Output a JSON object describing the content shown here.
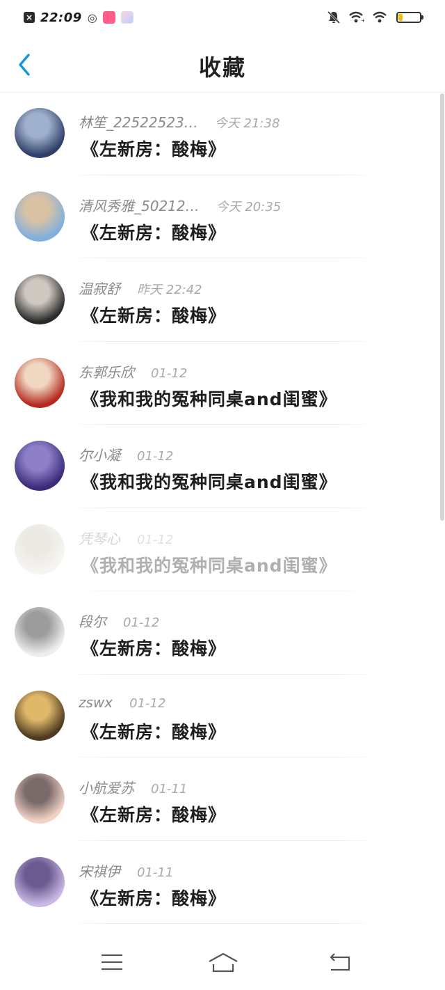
{
  "status_bar": {
    "time": "22:09",
    "battery_level": 0.2,
    "icons": [
      "close-notification-icon",
      "weibo-icon",
      "app-icon-1",
      "app-icon-2",
      "mute-bell-icon",
      "wifi-calling-icon",
      "wifi-icon",
      "battery-icon"
    ]
  },
  "header": {
    "title": "收藏",
    "back_icon": "chevron-left-icon"
  },
  "colors": {
    "accent": "#1296db",
    "name": "#8a8a8a",
    "time": "#a9a9a9",
    "title": "#1e1e1e",
    "battery": "#f5c000"
  },
  "items": [
    {
      "name": "林笙_22522523…",
      "time": "今天 21:38",
      "title": "《左新房：酸梅》",
      "avatar_colors": [
        "#2f3f69",
        "#9fb0cc"
      ]
    },
    {
      "name": "清风秀雅_50212…",
      "time": "今天 20:35",
      "title": "《左新房：酸梅》",
      "avatar_colors": [
        "#7fb0dd",
        "#d9c2a4"
      ]
    },
    {
      "name": "温寂舒",
      "time": "昨天 22:42",
      "title": "《左新房：酸梅》",
      "avatar_colors": [
        "#2a2a2a",
        "#cfc8c0"
      ]
    },
    {
      "name": "东郭乐欣",
      "time": "01-12",
      "title": "《我和我的冤种同桌and闺蜜》",
      "avatar_colors": [
        "#b52a1f",
        "#f0d7c2"
      ]
    },
    {
      "name": "尔小凝",
      "time": "01-12",
      "title": "《我和我的冤种同桌and闺蜜》",
      "avatar_colors": [
        "#3b2b7a",
        "#8d80c8"
      ]
    },
    {
      "name": "凭琴心",
      "time": "01-12",
      "title": "《我和我的冤种同桌and闺蜜》",
      "avatar_colors": [
        "#e9e4d8",
        "#c9c2b2"
      ],
      "faded": true
    },
    {
      "name": "段尔",
      "time": "01-12",
      "title": "《左新房：酸梅》",
      "avatar_colors": [
        "#eeeeee",
        "#9c9c9c"
      ]
    },
    {
      "name": "zswx",
      "time": "01-12",
      "title": "《左新房：酸梅》",
      "avatar_colors": [
        "#4d3a1f",
        "#e0b86a"
      ]
    },
    {
      "name": "小航爱苏",
      "time": "01-11",
      "title": "《左新房：酸梅》",
      "avatar_colors": [
        "#f2d2c6",
        "#7a6a6a"
      ]
    },
    {
      "name": "宋祺伊",
      "time": "01-11",
      "title": "《左新房：酸梅》",
      "avatar_colors": [
        "#c9b8e6",
        "#6b5a8f"
      ]
    }
  ],
  "nav_bar": {
    "menu_icon": "menu-icon",
    "home_icon": "home-icon",
    "back_icon": "back-arrow-icon"
  }
}
